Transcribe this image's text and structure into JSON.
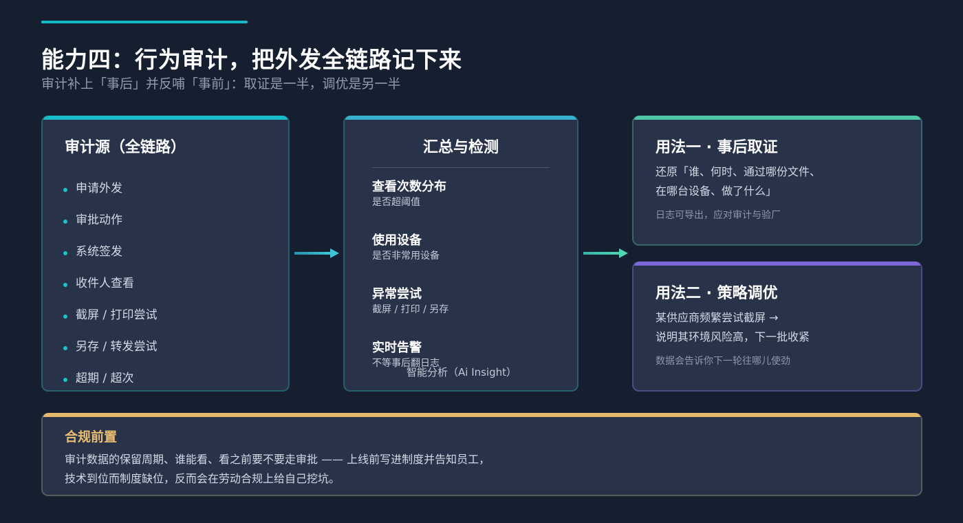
{
  "header": {
    "title": "能力四：行为审计，把外发全链路记下来",
    "subtitle": "审计补上「事后」并反哺「事前」：取证是一半，调优是另一半"
  },
  "source_card": {
    "title": "审计源（全链路）",
    "items": [
      "申请外发",
      "审批动作",
      "系统签发",
      "收件人查看",
      "截屏 / 打印尝试",
      "另存 / 转发尝试",
      "超期 / 超次"
    ]
  },
  "detect_card": {
    "title": "汇总与检测",
    "items": [
      {
        "heading": "查看次数分布",
        "desc": "是否超阈值"
      },
      {
        "heading": "使用设备",
        "desc": "是否非常用设备"
      },
      {
        "heading": "异常尝试",
        "desc": "截屏 / 打印 / 另存"
      },
      {
        "heading": "实时告警",
        "desc": "不等事后翻日志"
      }
    ],
    "footnote": "智能分析（Ai Insight）"
  },
  "use_card_1": {
    "title": "用法一 · 事后取证",
    "desc_line1": "还原「谁、何时、通过哪份文件、",
    "desc_line2": "在哪台设备、做了什么」",
    "note": "日志可导出，应对审计与验厂"
  },
  "use_card_2": {
    "title": "用法二 · 策略调优",
    "desc_line1": "某供应商频繁尝试截屏 →",
    "desc_line2": "说明其环境风险高，下一批收紧",
    "note": "数据会告诉你下一轮往哪儿使劲"
  },
  "compliance": {
    "title": "合规前置",
    "line1": "审计数据的保留周期、谁能看、看之前要不要走审批 —— 上线前写进制度并告知员工，",
    "line2": "技术到位而制度缺位，反而会在劳动合规上给自己挖坑。"
  },
  "colors": {
    "background": "#161f30",
    "card": "#283249",
    "accent_cyan": "#17bccb",
    "accent_teal": "#4fc7a6",
    "accent_purple": "#7b67d6",
    "accent_gold": "#e3b96b"
  },
  "icons": [
    "bullet-dot-icon",
    "arrow-right-icon"
  ]
}
